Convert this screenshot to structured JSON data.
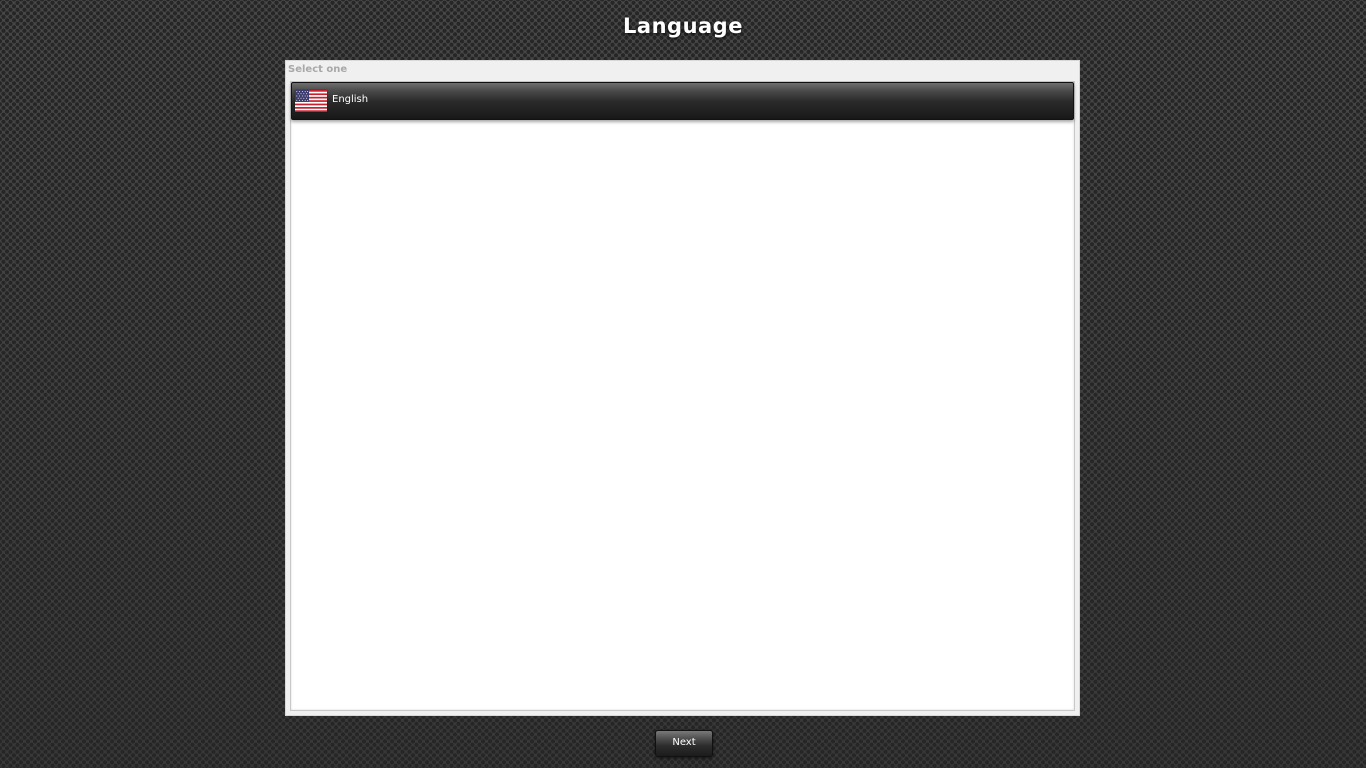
{
  "page": {
    "title": "Language"
  },
  "language_panel": {
    "header": "Select one",
    "items": [
      {
        "label": "English",
        "icon": "us-flag-icon",
        "selected": true
      }
    ]
  },
  "footer": {
    "next_label": "Next"
  }
}
